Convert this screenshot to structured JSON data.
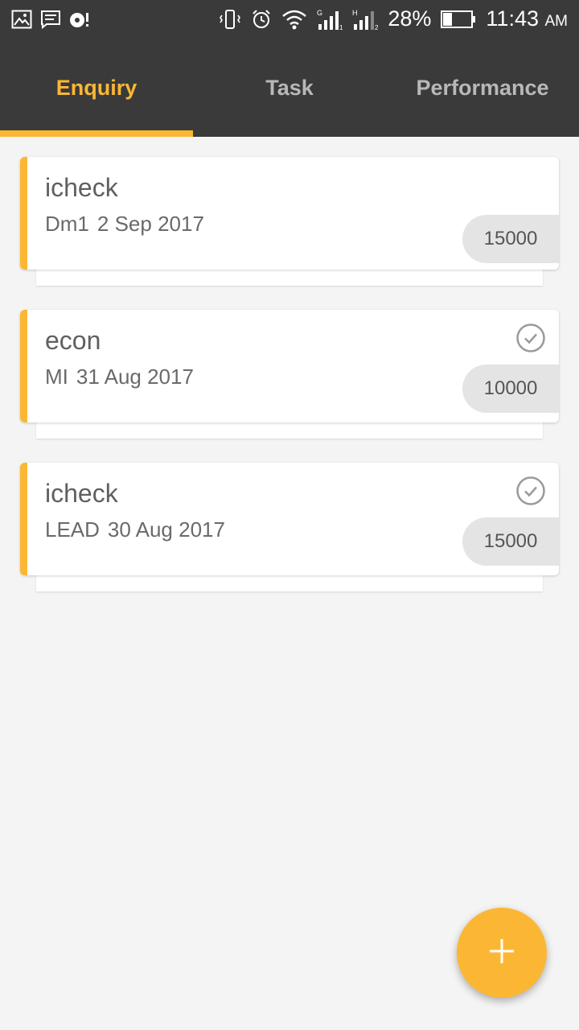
{
  "status_bar": {
    "battery": "28%",
    "time": "11:43",
    "ampm": "AM",
    "icons": [
      "gallery-icon",
      "message-icon",
      "sync-alert-icon",
      "vibrate-icon",
      "alarm-icon",
      "wifi-icon",
      "signal-g-icon",
      "signal-h-icon",
      "battery-icon"
    ]
  },
  "tabs": [
    {
      "label": "Enquiry",
      "active": true
    },
    {
      "label": "Task",
      "active": false
    },
    {
      "label": "Performance",
      "active": false
    }
  ],
  "enquiries": [
    {
      "title": "icheck",
      "code": "Dm1",
      "date": "2 Sep 2017",
      "amount": "15000",
      "checked": false
    },
    {
      "title": "econ",
      "code": "MI",
      "date": "31 Aug 2017",
      "amount": "10000",
      "checked": true
    },
    {
      "title": "icheck",
      "code": "LEAD",
      "date": "30 Aug 2017",
      "amount": "15000",
      "checked": true
    }
  ],
  "fab": {
    "icon": "plus-icon"
  },
  "colors": {
    "accent": "#fbb734",
    "toolbar": "#3a3a3a",
    "background": "#f4f4f4"
  }
}
